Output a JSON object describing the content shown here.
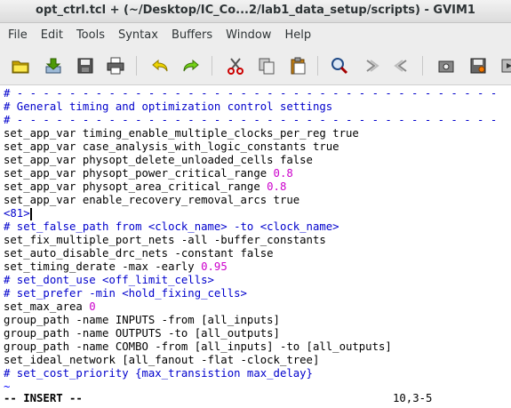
{
  "window": {
    "title": "opt_ctrl.tcl + (~/Desktop/IC_Co...2/lab1_data_setup/scripts) - GVIM1"
  },
  "menu": [
    "File",
    "Edit",
    "Tools",
    "Syntax",
    "Buffers",
    "Window",
    "Help"
  ],
  "toolbar": [
    {
      "name": "open-file-icon"
    },
    {
      "name": "save-download-icon"
    },
    {
      "name": "save-icon"
    },
    {
      "name": "print-icon"
    },
    {
      "name": "undo-icon"
    },
    {
      "name": "redo-icon"
    },
    {
      "name": "cut-icon"
    },
    {
      "name": "copy-icon"
    },
    {
      "name": "paste-icon"
    },
    {
      "name": "find-replace-icon"
    },
    {
      "name": "find-next-icon"
    },
    {
      "name": "find-previous-icon"
    },
    {
      "name": "load-session-icon"
    },
    {
      "name": "save-session-icon"
    },
    {
      "name": "run-script-icon"
    }
  ],
  "editor": {
    "lines": [
      {
        "kind": "comment",
        "text": "# - - - - - - - - - - - - - - - - - - - - - - - - - - - - - - - - - - - - -"
      },
      {
        "kind": "comment",
        "text": "# General timing and optimization control settings"
      },
      {
        "kind": "comment",
        "text": "# - - - - - - - - - - - - - - - - - - - - - - - - - - - - - - - - - - - - -"
      },
      {
        "kind": "code",
        "text": "set_app_var timing_enable_multiple_clocks_per_reg true"
      },
      {
        "kind": "code",
        "text": "set_app_var case_analysis_with_logic_constants true"
      },
      {
        "kind": "code",
        "text": "set_app_var physopt_delete_unloaded_cells false"
      },
      {
        "kind": "code",
        "text": "set_app_var physopt_power_critical_range ",
        "num": "0.8"
      },
      {
        "kind": "code",
        "text": "set_app_var physopt_area_critical_range ",
        "num": "0.8"
      },
      {
        "kind": "code",
        "text": "set_app_var enable_recovery_removal_arcs true"
      },
      {
        "kind": "comment",
        "text": "<81>",
        "cursor": true
      },
      {
        "kind": "comment",
        "text": "# set_false_path from <clock_name> -to <clock_name>"
      },
      {
        "kind": "code",
        "text": "set_fix_multiple_port_nets -all -buffer_constants"
      },
      {
        "kind": "code",
        "text": "set_auto_disable_drc_nets -constant false"
      },
      {
        "kind": "code",
        "text": "set_timing_derate -max -early ",
        "num": "0.95"
      },
      {
        "kind": "comment",
        "text": "# set_dont_use <off_limit_cells>"
      },
      {
        "kind": "comment",
        "text": "# set_prefer -min <hold_fixing_cells>"
      },
      {
        "kind": "code",
        "text": "set_max_area ",
        "num": "0"
      },
      {
        "kind": "code",
        "text": "group_path -name INPUTS -from [all_inputs]"
      },
      {
        "kind": "code",
        "text": "group_path -name OUTPUTS -to [all_outputs]"
      },
      {
        "kind": "code",
        "text": "group_path -name COMBO -from [all_inputs] -to [all_outputs]"
      },
      {
        "kind": "code",
        "text": "set_ideal_network [all_fanout -flat -clock_tree]"
      },
      {
        "kind": "comment",
        "text": "# set_cost_priority {max_transistion max_delay}"
      },
      {
        "kind": "tilde",
        "text": "~"
      }
    ]
  },
  "status": {
    "mode": "-- INSERT --",
    "position": "10,3-5"
  },
  "colors": {
    "comment": "#0000cc",
    "number": "#cc00cc",
    "text": "#000000"
  }
}
